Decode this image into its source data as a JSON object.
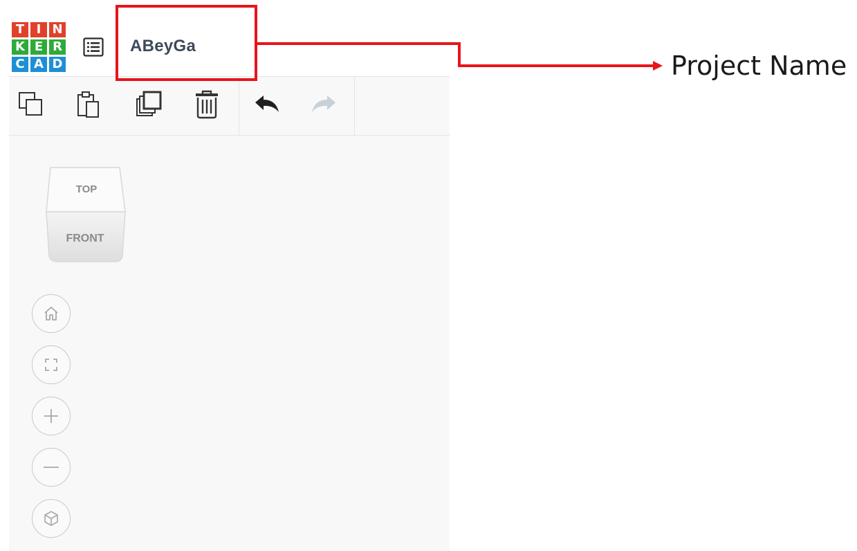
{
  "logo": {
    "tiles": [
      {
        "letter": "T",
        "color": "#e0412b"
      },
      {
        "letter": "I",
        "color": "#e0412b"
      },
      {
        "letter": "N",
        "color": "#e0412b"
      },
      {
        "letter": "K",
        "color": "#2faa3a"
      },
      {
        "letter": "E",
        "color": "#2faa3a"
      },
      {
        "letter": "R",
        "color": "#2faa3a"
      },
      {
        "letter": "C",
        "color": "#1d8fd6"
      },
      {
        "letter": "A",
        "color": "#1d8fd6"
      },
      {
        "letter": "D",
        "color": "#1d8fd6"
      }
    ]
  },
  "header": {
    "menu_icon": "list-icon",
    "project_name": "ABeyGa"
  },
  "toolbar": {
    "buttons": [
      {
        "icon": "copy-icon"
      },
      {
        "icon": "paste-icon"
      },
      {
        "icon": "duplicate-icon"
      },
      {
        "icon": "trash-icon"
      },
      {
        "icon": "undo-icon"
      },
      {
        "icon": "redo-icon",
        "state": "disabled"
      }
    ]
  },
  "viewcube": {
    "top_label": "TOP",
    "front_label": "FRONT"
  },
  "view_controls": [
    {
      "icon": "home-icon"
    },
    {
      "icon": "fit-view-icon"
    },
    {
      "icon": "zoom-in-icon"
    },
    {
      "icon": "zoom-out-icon"
    },
    {
      "icon": "perspective-cube-icon"
    }
  ],
  "annotation": {
    "label": "Project Name",
    "color": "#e8141c"
  }
}
